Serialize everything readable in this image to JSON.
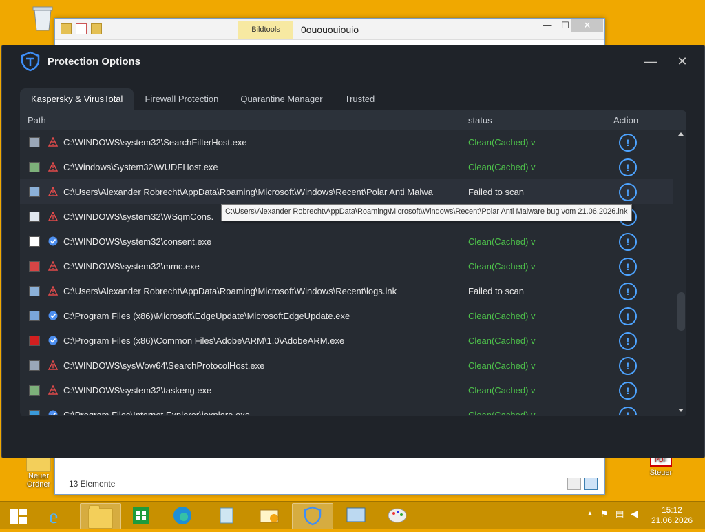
{
  "desktop": {
    "icons": [
      {
        "label": "Papierkorb",
        "name": "recycle-bin-icon"
      },
      {
        "label": "Neuer Ordner",
        "name": "folder-icon"
      },
      {
        "label": "Steuer",
        "name": "pdf-file-icon"
      }
    ]
  },
  "explorer": {
    "title": "0ouououiouio",
    "context_tab": "Bildtools",
    "item_count": "13 Elemente",
    "minimize": "—",
    "maximize": "☐",
    "close": "✕"
  },
  "app": {
    "title": "Protection Options",
    "minimize_glyph": "—",
    "close_glyph": "✕",
    "tabs": [
      {
        "label": "Kaspersky & VirusTotal",
        "active": true
      },
      {
        "label": "Firewall Protection",
        "active": false
      },
      {
        "label": "Quarantine Manager",
        "active": false
      },
      {
        "label": "Trusted",
        "active": false
      }
    ],
    "columns": {
      "path": "Path",
      "status": "status",
      "action": "Action"
    },
    "action_glyph": "!",
    "rows": [
      {
        "file_icon": "search-host-icon",
        "flag": "warning",
        "path": "C:\\WINDOWS\\system32\\SearchFilterHost.exe",
        "status": "Clean(Cached) v",
        "status_kind": "clean"
      },
      {
        "file_icon": "app-window-icon",
        "flag": "warning",
        "path": "C:\\Windows\\System32\\WUDFHost.exe",
        "status": "Clean(Cached) v",
        "status_kind": "clean"
      },
      {
        "file_icon": "shortcut-icon",
        "flag": "warning",
        "path": "C:\\Users\\Alexander Robrecht\\AppData\\Roaming\\Microsoft\\Windows\\Recent\\Polar Anti Malwa",
        "status": "Failed to scan",
        "status_kind": "failed"
      },
      {
        "file_icon": "document-icon",
        "flag": "warning",
        "path": "C:\\WINDOWS\\system32\\WSqmCons.",
        "status": "",
        "status_kind": "clean"
      },
      {
        "file_icon": "window-icon",
        "flag": "verified",
        "path": "C:\\WINDOWS\\system32\\consent.exe",
        "status": "Clean(Cached) v",
        "status_kind": "clean"
      },
      {
        "file_icon": "mmc-icon",
        "flag": "warning",
        "path": "C:\\WINDOWS\\system32\\mmc.exe",
        "status": "Clean(Cached) v",
        "status_kind": "clean"
      },
      {
        "file_icon": "shortcut-icon",
        "flag": "warning",
        "path": "C:\\Users\\Alexander Robrecht\\AppData\\Roaming\\Microsoft\\Windows\\Recent\\logs.lnk",
        "status": "Failed to scan",
        "status_kind": "failed"
      },
      {
        "file_icon": "edge-update-icon",
        "flag": "verified",
        "path": "C:\\Program Files (x86)\\Microsoft\\EdgeUpdate\\MicrosoftEdgeUpdate.exe",
        "status": "Clean(Cached) v",
        "status_kind": "clean"
      },
      {
        "file_icon": "adobe-icon",
        "flag": "verified",
        "path": "C:\\Program Files (x86)\\Common Files\\Adobe\\ARM\\1.0\\AdobeARM.exe",
        "status": "Clean(Cached) v",
        "status_kind": "clean"
      },
      {
        "file_icon": "search-host-icon",
        "flag": "warning",
        "path": "C:\\WINDOWS\\sysWow64\\SearchProtocolHost.exe",
        "status": "Clean(Cached) v",
        "status_kind": "clean"
      },
      {
        "file_icon": "app-window-icon",
        "flag": "warning",
        "path": "C:\\WINDOWS\\system32\\taskeng.exe",
        "status": "Clean(Cached) v",
        "status_kind": "clean"
      },
      {
        "file_icon": "ie-icon",
        "flag": "verified",
        "path": "C:\\Program Files\\Internet Explorer\\iexplore.exe",
        "status": "Clean(Cached) v",
        "status_kind": "clean"
      }
    ],
    "tooltip": "C:\\Users\\Alexander Robrecht\\AppData\\Roaming\\Microsoft\\Windows\\Recent\\Polar Anti Malware bug vom 21.06.2026.lnk"
  },
  "taskbar": {
    "clock_time": "15:12",
    "clock_date": "21.06.2026"
  },
  "colors": {
    "accent_blue": "#4da3ff",
    "clean_green": "#4ec24b",
    "warning_red": "#e24b4b",
    "desktop_orange": "#f0a800"
  }
}
